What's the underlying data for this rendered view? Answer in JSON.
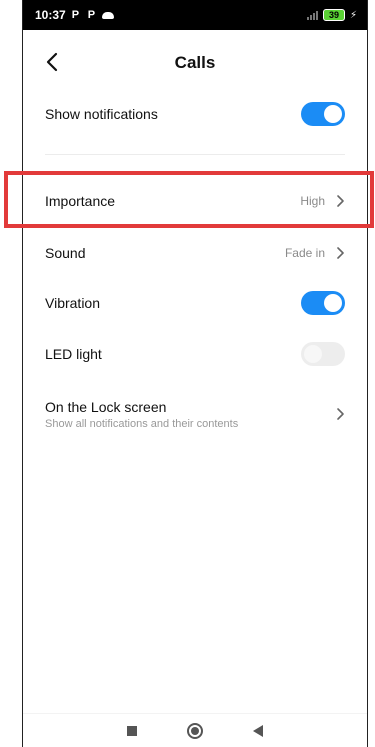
{
  "status_bar": {
    "time": "10:37",
    "notif_icons": [
      "P",
      "P"
    ],
    "battery": "39"
  },
  "header": {
    "title": "Calls"
  },
  "settings": {
    "show_notifications": {
      "label": "Show notifications",
      "enabled": true
    },
    "importance": {
      "label": "Importance",
      "value": "High"
    },
    "sound": {
      "label": "Sound",
      "value": "Fade in"
    },
    "vibration": {
      "label": "Vibration",
      "enabled": true
    },
    "led_light": {
      "label": "LED light",
      "enabled": false
    },
    "lock_screen": {
      "label": "On the Lock screen",
      "sublabel": "Show all notifications and their contents"
    }
  },
  "colors": {
    "accent": "#1b8cf5",
    "highlight": "#e23a3a"
  }
}
